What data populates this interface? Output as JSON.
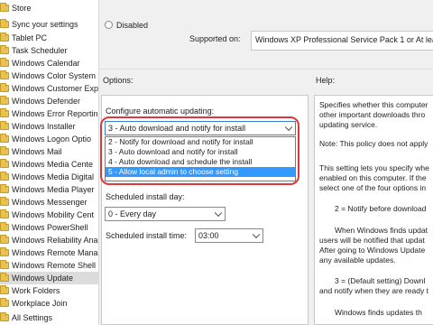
{
  "tree": {
    "items": [
      "Store",
      "Sync your settings",
      "Tablet PC",
      "Task Scheduler",
      "Windows Calendar",
      "Windows Color System",
      "Windows Customer Exp",
      "Windows Defender",
      "Windows Error Reportin",
      "Windows Installer",
      "Windows Logon Optio",
      "Windows Mail",
      "Windows Media Cente",
      "Windows Media Digital",
      "Windows Media Player",
      "Windows Messenger",
      "Windows Mobility Cent",
      "Windows PowerShell",
      "Windows Reliability Ana",
      "Windows Remote Mana",
      "Windows Remote Shell",
      "Windows Update",
      "Work Folders",
      "Workplace Join",
      "All Settings"
    ],
    "selected_index": 21
  },
  "policy": {
    "disabled_label": "Disabled",
    "supported_on_label": "Supported on:",
    "supported_on_value": "Windows XP Professional Service Pack 1 or At lea",
    "options_label": "Options:",
    "help_label": "Help:"
  },
  "options": {
    "configure_label": "Configure automatic updating:",
    "configure_value": "3 - Auto download and notify for install",
    "dropdown_options": [
      "2 - Notify for download and notify for install",
      "3 - Auto download and notify for install",
      "4 - Auto download and schedule the install",
      "5 - Allow local admin to choose setting"
    ],
    "dropdown_selected_index": 3,
    "scheduled_day_label": "Scheduled install day:",
    "scheduled_day_value": "0 - Every day",
    "scheduled_time_label": "Scheduled install time:",
    "scheduled_time_value": "03:00"
  },
  "help": {
    "lines": [
      "Specifies whether this computer",
      "other important downloads thro",
      "updating service.",
      "Note: This policy does not apply",
      "This setting lets you specify whe",
      "enabled on this computer. If the",
      "select one of the four options in",
      "2 = Notify before download",
      "When Windows finds updat",
      "users will be notified that updat",
      "After going to Windows Update",
      "any available updates.",
      "3 = (Default setting) Downl",
      "and notify when they are ready t",
      "Windows finds updates th"
    ]
  },
  "colors": {
    "selection": "#3399ff",
    "highlight_ring": "#d93a3a",
    "folder": "#e8c352"
  }
}
